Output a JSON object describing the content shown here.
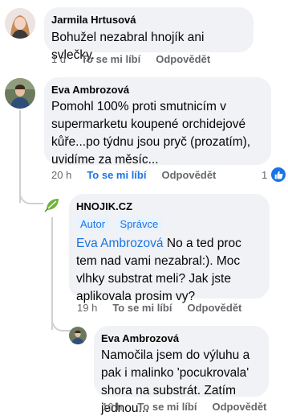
{
  "colors": {
    "bubble": "#f0f2f5",
    "accent": "#1b74e4",
    "secondary_text": "#65676b",
    "thread_line": "#ced0d4"
  },
  "comments": [
    {
      "author": "Jarmila Hrtusová",
      "text": "Bohužel nezabral hnojík ani svlečky.",
      "time": "1 d",
      "like_label": "To se mi líbí",
      "reply_label": "Odpovědět",
      "avatar_icon": "user-photo"
    },
    {
      "author": "Eva Ambrozová",
      "text": "Pomohl 100% proti smutnicím v supermarketu koupené orchidejové kůře...po týdnu jsou pryč (prozatím), uvidíme za měsíc...",
      "time": "20 h",
      "like_label": "To se mi líbí",
      "reply_label": "Odpovědět",
      "reaction_count": "1",
      "reaction_icon": "like-icon",
      "avatar_icon": "user-photo"
    }
  ],
  "replies": [
    {
      "author": "HNOJIK.CZ",
      "badges": [
        "Autor",
        "Správce"
      ],
      "mention": "Eva Ambrozová",
      "text": " No a ted proc tem nad vami nezabral:). Moc vlhky substrat meli? Jak jste aplikovala prosim vy?",
      "time": "19 h",
      "like_label": "To se mi líbí",
      "reply_label": "Odpovědět",
      "avatar_icon": "leaf-logo"
    },
    {
      "author": "Eva Ambrozová",
      "text": "Namočila jsem do výluhu a pak i malinko 'pocukrovala' shora na substrát. Zatím jednou...",
      "time": "16 h",
      "like_label": "To se mi líbí",
      "reply_label": "Odpovědět",
      "avatar_icon": "user-photo"
    }
  ]
}
